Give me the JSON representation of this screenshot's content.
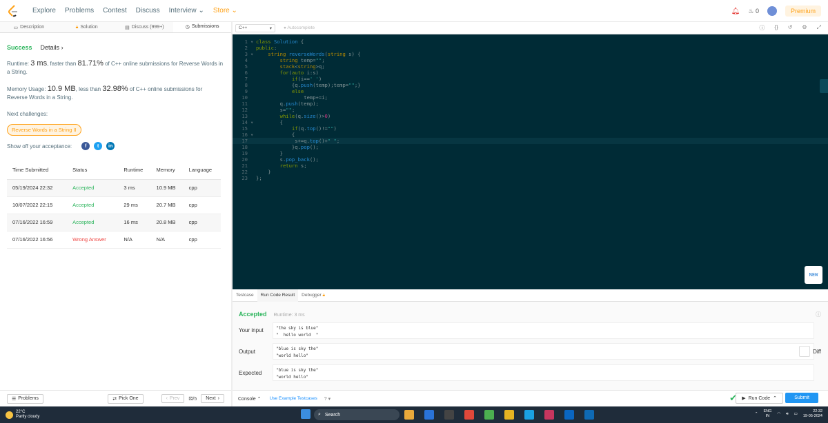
{
  "nav": {
    "items": [
      "Explore",
      "Problems",
      "Contest",
      "Discuss",
      "Interview",
      "Store"
    ],
    "notif_count": "0",
    "premium": "Premium"
  },
  "tabs": [
    "Description",
    "Solution",
    "Discuss (999+)",
    "Submissions"
  ],
  "submission": {
    "status": "Success",
    "details": "Details",
    "runtime_prefix": "Runtime: ",
    "runtime": "3 ms",
    "runtime_mid": ", faster than ",
    "runtime_pct": "81.71%",
    "runtime_suffix": " of C++ online submissions for Reverse Words in a String.",
    "mem_prefix": "Memory Usage: ",
    "mem": "10.9 MB",
    "mem_mid": ", less than ",
    "mem_pct": "32.98%",
    "mem_suffix": " of C++ online submissions for Reverse Words in a String.",
    "next": "Next challenges:",
    "challenge": "Reverse Words in a String II",
    "share": "Show off your acceptance:"
  },
  "table": {
    "headers": [
      "Time Submitted",
      "Status",
      "Runtime",
      "Memory",
      "Language"
    ],
    "rows": [
      [
        "05/19/2024 22:32",
        "Accepted",
        "3 ms",
        "10.9 MB",
        "cpp"
      ],
      [
        "10/07/2022 22:15",
        "Accepted",
        "29 ms",
        "20.7 MB",
        "cpp"
      ],
      [
        "07/16/2022 16:59",
        "Accepted",
        "16 ms",
        "20.8 MB",
        "cpp"
      ],
      [
        "07/16/2022 16:56",
        "Wrong Answer",
        "N/A",
        "N/A",
        "cpp"
      ]
    ]
  },
  "leftfoot": {
    "problems": "Problems",
    "pick": "Pick One",
    "prev": "Prev",
    "page": "/5",
    "next": "Next"
  },
  "editor": {
    "lang": "C++",
    "autocomplete": "Autocomplete",
    "new": "NEW"
  },
  "code": [
    "class Solution {",
    "public:",
    "    string reverseWords(string s) {",
    "        string temp=\"\";",
    "        stack<string>q;",
    "        for(auto i:s)",
    "            if(i==' ')",
    "            {q.push(temp);temp=\"\";}",
    "            else",
    "                temp+=i;",
    "        q.push(temp);",
    "        s=\"\";",
    "        while(q.size()>0)",
    "        {",
    "            if(q.top()!=\"\")",
    "            {",
    "             s+=q.top()+\" \";",
    "            }q.pop();",
    "        }",
    "        s.pop_back();",
    "        return s;",
    "    }",
    "};"
  ],
  "results": {
    "tabs": [
      "Testcase",
      "Run Code Result",
      "Debugger"
    ],
    "status": "Accepted",
    "runtime": "Runtime: 3 ms",
    "input_label": "Your input",
    "input": "\"the sky is blue\"\n\"  hello world  \"",
    "output_label": "Output",
    "output": "\"blue is sky the\"\n\"world hello\"",
    "expected_label": "Expected",
    "expected": "\"blue is sky the\"\n\"world hello\"",
    "diff": "Diff"
  },
  "rightfoot": {
    "console": "Console",
    "example": "Use Example Testcases",
    "run": "Run Code",
    "submit": "Submit"
  },
  "taskbar": {
    "temp": "22°C",
    "weather": "Partly cloudy",
    "search": "Search",
    "lang": "ENG",
    "region": "IN",
    "time": "22:32",
    "date": "19-05-2024"
  }
}
